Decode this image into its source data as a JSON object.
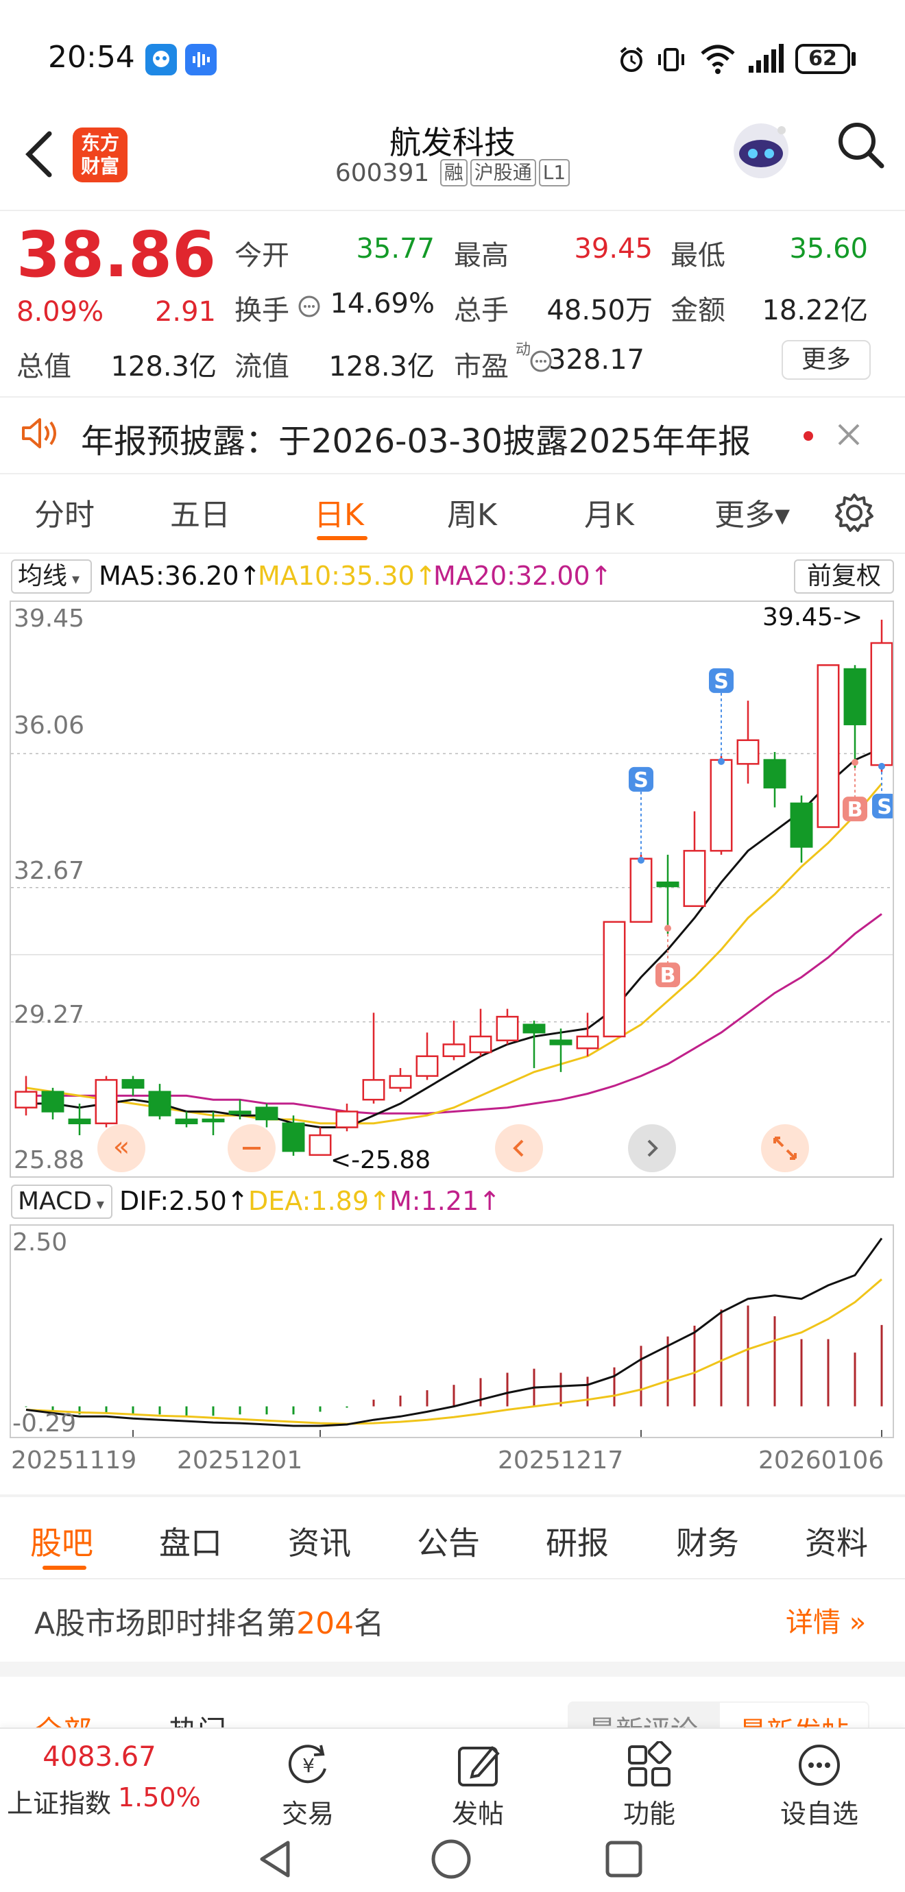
{
  "status_bar": {
    "time": "20:54",
    "battery": "62"
  },
  "header": {
    "title": "航发科技",
    "code": "600391",
    "tags": [
      "融",
      "沪股通",
      "L1"
    ],
    "logo_text": [
      "东方",
      "财富"
    ]
  },
  "quote": {
    "price": "38.86",
    "change_pct": "8.09%",
    "change": "2.91",
    "rows": [
      [
        {
          "label": "今开",
          "value": "35.77",
          "color": "green"
        },
        {
          "label": "最高",
          "value": "39.45",
          "color": "red"
        },
        {
          "label": "最低",
          "value": "35.60",
          "color": "green"
        }
      ],
      [
        {
          "label": "换手",
          "value": "14.69%",
          "color": "black"
        },
        {
          "label": "总手",
          "value": "48.50万",
          "color": "black"
        },
        {
          "label": "金额",
          "value": "18.22亿",
          "color": "black"
        }
      ]
    ],
    "total_value_label": "总值",
    "total_value": "128.3亿",
    "float_value_label": "流值",
    "float_value": "128.3亿",
    "pe_label": "市盈",
    "pe_superscript": "动",
    "pe_value": "328.17",
    "more_label": "更多"
  },
  "notice": {
    "text": "年报预披露：于2026-03-30披露2025年年报"
  },
  "period_tabs": [
    "分时",
    "五日",
    "日K",
    "周K",
    "月K",
    "更多▾"
  ],
  "active_period": "日K",
  "ma_bar": {
    "type_label": "均线",
    "ma5": "MA5:36.20↑",
    "ma10": "MA10:35.30↑",
    "ma20": "MA20:32.00↑",
    "adjust_label": "前复权"
  },
  "colors": {
    "up": "#e0262e",
    "down": "#139a27",
    "ma5": "#111111",
    "ma10": "#f0c419",
    "ma20": "#c0208a",
    "accent": "#ff6600"
  },
  "chart_data": [
    {
      "type": "candlestick",
      "ylim": [
        25.88,
        39.45
      ],
      "y_ticks": [
        "39.45",
        "36.06",
        "32.67",
        "29.27",
        "25.88"
      ],
      "max_marker": "39.45->",
      "min_marker": "<-25.88",
      "candles": [
        {
          "o": 27.1,
          "c": 27.5,
          "h": 27.9,
          "l": 26.9
        },
        {
          "o": 27.5,
          "c": 27.0,
          "h": 27.6,
          "l": 26.8
        },
        {
          "o": 26.8,
          "c": 26.7,
          "h": 27.2,
          "l": 26.4
        },
        {
          "o": 26.7,
          "c": 27.8,
          "h": 27.9,
          "l": 26.6
        },
        {
          "o": 27.8,
          "c": 27.6,
          "h": 27.9,
          "l": 27.4
        },
        {
          "o": 27.5,
          "c": 26.9,
          "h": 27.7,
          "l": 26.8
        },
        {
          "o": 26.8,
          "c": 26.7,
          "h": 27.0,
          "l": 26.6
        },
        {
          "o": 26.8,
          "c": 26.75,
          "h": 27.0,
          "l": 26.4
        },
        {
          "o": 27.0,
          "c": 26.95,
          "h": 27.3,
          "l": 26.8
        },
        {
          "o": 27.1,
          "c": 26.8,
          "h": 27.2,
          "l": 26.6
        },
        {
          "o": 26.7,
          "c": 26.0,
          "h": 26.9,
          "l": 25.88
        },
        {
          "o": 25.9,
          "c": 26.4,
          "h": 26.6,
          "l": 25.88
        },
        {
          "o": 26.6,
          "c": 27.0,
          "h": 27.2,
          "l": 26.5
        },
        {
          "o": 27.3,
          "c": 27.8,
          "h": 29.5,
          "l": 27.2
        },
        {
          "o": 27.6,
          "c": 27.9,
          "h": 28.1,
          "l": 27.5
        },
        {
          "o": 27.9,
          "c": 28.4,
          "h": 29.0,
          "l": 27.8
        },
        {
          "o": 28.4,
          "c": 28.7,
          "h": 29.3,
          "l": 28.3
        },
        {
          "o": 28.5,
          "c": 28.9,
          "h": 29.6,
          "l": 28.4
        },
        {
          "o": 28.8,
          "c": 29.4,
          "h": 29.6,
          "l": 28.7
        },
        {
          "o": 29.2,
          "c": 29.0,
          "h": 29.3,
          "l": 28.1
        },
        {
          "o": 28.8,
          "c": 28.7,
          "h": 29.1,
          "l": 28.0
        },
        {
          "o": 28.6,
          "c": 28.9,
          "h": 29.5,
          "l": 28.4
        },
        {
          "o": 28.9,
          "c": 31.8,
          "h": 31.8,
          "l": 28.9
        },
        {
          "o": 31.8,
          "c": 33.4,
          "h": 33.5,
          "l": 31.8
        },
        {
          "o": 32.8,
          "c": 32.7,
          "h": 33.5,
          "l": 31.5
        },
        {
          "o": 32.2,
          "c": 33.6,
          "h": 34.6,
          "l": 32.2
        },
        {
          "o": 33.6,
          "c": 35.9,
          "h": 36.0,
          "l": 33.5
        },
        {
          "o": 35.8,
          "c": 36.4,
          "h": 37.4,
          "l": 35.3
        },
        {
          "o": 35.9,
          "c": 35.2,
          "h": 36.1,
          "l": 34.7
        },
        {
          "o": 34.8,
          "c": 33.7,
          "h": 35.0,
          "l": 33.3
        },
        {
          "o": 34.2,
          "c": 38.3,
          "h": 38.3,
          "l": 34.2
        },
        {
          "o": 38.2,
          "c": 36.8,
          "h": 38.3,
          "l": 35.7
        },
        {
          "o": 35.77,
          "c": 38.86,
          "h": 39.45,
          "l": 35.6
        }
      ],
      "ma5": [
        27.2,
        27.2,
        27.1,
        27.2,
        27.3,
        27.2,
        27.0,
        27.0,
        26.9,
        26.9,
        26.7,
        26.6,
        26.6,
        26.9,
        27.2,
        27.6,
        28.0,
        28.4,
        28.7,
        28.9,
        29.0,
        29.1,
        29.6,
        30.4,
        31.1,
        31.9,
        32.8,
        33.6,
        34.1,
        34.6,
        35.3,
        35.9,
        36.2
      ],
      "ma10": [
        27.6,
        27.5,
        27.4,
        27.3,
        27.2,
        27.1,
        27.0,
        26.9,
        26.9,
        26.8,
        26.8,
        26.7,
        26.7,
        26.7,
        26.8,
        26.9,
        27.1,
        27.4,
        27.7,
        28.0,
        28.2,
        28.4,
        28.8,
        29.2,
        29.8,
        30.4,
        31.1,
        31.9,
        32.5,
        33.2,
        33.8,
        34.5,
        35.3
      ],
      "ma20": [
        27.4,
        27.4,
        27.4,
        27.4,
        27.4,
        27.4,
        27.4,
        27.3,
        27.3,
        27.2,
        27.2,
        27.1,
        27.0,
        26.95,
        26.95,
        26.95,
        27.0,
        27.05,
        27.1,
        27.2,
        27.3,
        27.45,
        27.65,
        27.9,
        28.2,
        28.6,
        29.0,
        29.5,
        30.0,
        30.4,
        30.9,
        31.5,
        32.0
      ],
      "markers": [
        {
          "i": 23,
          "label": "S",
          "side": "top"
        },
        {
          "i": 24,
          "label": "B",
          "side": "bottom"
        },
        {
          "i": 26,
          "label": "S",
          "side": "top"
        },
        {
          "i": 31,
          "label": "B",
          "side": "bottom"
        },
        {
          "i": 32,
          "label": "S",
          "side": "right"
        }
      ]
    },
    {
      "type": "macd",
      "indicator_label": "MACD",
      "dif_label": "DIF:2.50↑",
      "dea_label": "DEA:1.89↑",
      "m_label": "M:1.21↑",
      "ylim": [
        -0.29,
        2.5
      ],
      "y_ticks": [
        "2.50",
        "-0.29"
      ],
      "dif": [
        -0.05,
        -0.1,
        -0.15,
        -0.15,
        -0.18,
        -0.2,
        -0.22,
        -0.24,
        -0.25,
        -0.27,
        -0.29,
        -0.29,
        -0.27,
        -0.2,
        -0.15,
        -0.08,
        0.0,
        0.1,
        0.2,
        0.28,
        0.3,
        0.32,
        0.45,
        0.7,
        0.9,
        1.1,
        1.4,
        1.6,
        1.65,
        1.6,
        1.8,
        1.95,
        2.5
      ],
      "dea": [
        -0.05,
        -0.07,
        -0.09,
        -0.1,
        -0.12,
        -0.14,
        -0.15,
        -0.17,
        -0.19,
        -0.21,
        -0.23,
        -0.25,
        -0.26,
        -0.25,
        -0.23,
        -0.2,
        -0.16,
        -0.11,
        -0.05,
        0.0,
        0.05,
        0.1,
        0.16,
        0.25,
        0.38,
        0.5,
        0.68,
        0.85,
        0.98,
        1.1,
        1.3,
        1.55,
        1.89
      ],
      "hist": [
        -0.01,
        -0.06,
        -0.12,
        -0.1,
        -0.12,
        -0.12,
        -0.14,
        -0.14,
        -0.12,
        -0.12,
        -0.12,
        -0.08,
        -0.02,
        0.1,
        0.16,
        0.24,
        0.32,
        0.42,
        0.5,
        0.56,
        0.5,
        0.44,
        0.58,
        0.9,
        1.04,
        1.2,
        1.44,
        1.5,
        1.34,
        1.0,
        1.0,
        0.8,
        1.21
      ],
      "x_labels": [
        "20251119",
        "20251201",
        "20251217",
        "20260106"
      ]
    }
  ],
  "sub_tabs": [
    "股吧",
    "盘口",
    "资讯",
    "公告",
    "研报",
    "财务",
    "资料"
  ],
  "active_sub_tab": "股吧",
  "ranking": {
    "prefix": "A股市场即时排名第",
    "rank": "204",
    "suffix": "名",
    "detail": "详情"
  },
  "filters": {
    "left": [
      "全部",
      "热门"
    ],
    "right": [
      "最新评论",
      "最新发帖"
    ]
  },
  "bottom_nav": {
    "index_value": "4083.67",
    "index_name": "上证指数",
    "index_change": "1.50%",
    "items": [
      "交易",
      "发帖",
      "功能",
      "设自选"
    ]
  }
}
